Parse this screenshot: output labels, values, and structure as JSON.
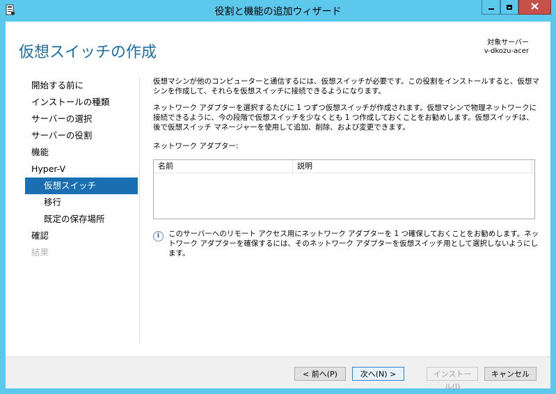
{
  "window": {
    "title": "役割と機能の追加ウィザード",
    "minimize_icon": "minimize-icon",
    "maximize_icon": "maximize-icon",
    "close_icon": "close-icon"
  },
  "header": {
    "page_title": "仮想スイッチの作成",
    "target_label": "対象サーバー",
    "target_server": "v-dkozu-acer"
  },
  "nav": {
    "items": [
      {
        "label": "開始する前に",
        "state": "normal"
      },
      {
        "label": "インストールの種類",
        "state": "normal"
      },
      {
        "label": "サーバーの選択",
        "state": "normal"
      },
      {
        "label": "サーバーの役割",
        "state": "normal"
      },
      {
        "label": "機能",
        "state": "normal"
      },
      {
        "label": "Hyper-V",
        "state": "normal"
      },
      {
        "label": "仮想スイッチ",
        "state": "active"
      },
      {
        "label": "移行",
        "state": "normal"
      },
      {
        "label": "既定の保存場所",
        "state": "normal"
      },
      {
        "label": "確認",
        "state": "normal"
      },
      {
        "label": "結果",
        "state": "disabled"
      }
    ]
  },
  "main": {
    "para1": "仮想マシンが他のコンピューターと通信するには、仮想スイッチが必要です。この役割をインストールすると、仮想マシンを作成して、それらを仮想スイッチに接続できるようになります。",
    "para2": "ネットワーク アダプターを選択するたびに 1 つずつ仮想スイッチが作成されます。仮想マシンで物理ネットワークに接続できるように、今の段階で仮想スイッチを少なくとも 1 つ作成しておくことをお勧めします。仮想スイッチは、後で仮想スイッチ マネージャーを使用して追加、削除、および変更できます。",
    "adapter_label": "ネットワーク アダプター:",
    "adapter_table": {
      "columns": [
        "名前",
        "説明"
      ],
      "rows": []
    },
    "info_icon": "info-icon",
    "info_text": "このサーバーへのリモート アクセス用にネットワーク アダプターを 1 つ確保しておくことをお勧めします。ネットワーク アダプターを確保するには、そのネットワーク アダプターを仮想スイッチ用として選択しないようにします。"
  },
  "footer": {
    "prev": "< 前へ(P)",
    "next": "次へ(N) >",
    "install": "インストール(I)",
    "cancel": "キャンセル"
  },
  "colors": {
    "title_bar": "#5bc8ec",
    "title_text": "#1c6ea4",
    "nav_active": "#1a6fb3",
    "close_button": "#c7504a"
  }
}
